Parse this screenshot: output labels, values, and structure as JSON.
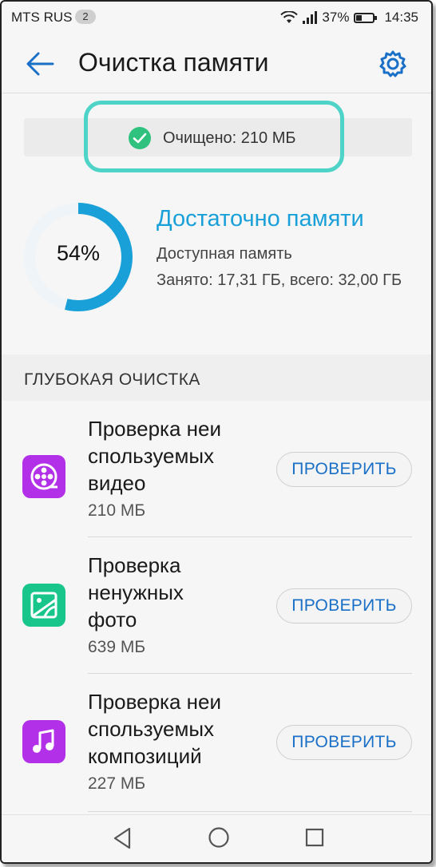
{
  "status_bar": {
    "carrier": "MTS RUS",
    "sim_badge": "2",
    "battery": "37%",
    "battery_level": 0.37,
    "time": "14:35"
  },
  "header": {
    "title": "Очистка памяти",
    "back_icon": "arrow-left-icon",
    "settings_icon": "gear-icon"
  },
  "banner": {
    "text": "Очищено: 210 МБ",
    "icon": "check-circle-icon",
    "highlight_color": "#4dd3c8"
  },
  "memory": {
    "percent_label": "54%",
    "percent": 54,
    "status": "Достаточно памяти",
    "available_label": "Доступная память",
    "used_text": "Занято: 17,31 ГБ, всего: 32,00 ГБ",
    "ring_color": "#1aa0d8"
  },
  "section": {
    "title": "ГЛУБОКАЯ ОЧИСТКА"
  },
  "items": [
    {
      "title_lines": [
        "Проверка неи",
        "спользуемых",
        "видео"
      ],
      "size": "210 МБ",
      "button": "ПРОВЕРИТЬ",
      "icon": "video-reel-icon",
      "icon_color": "#b230e8"
    },
    {
      "title_lines": [
        "Проверка",
        "ненужных",
        "фото"
      ],
      "size": "639 МБ",
      "button": "ПРОВЕРИТЬ",
      "icon": "photo-icon",
      "icon_color": "#18c58a"
    },
    {
      "title_lines": [
        "Проверка неи",
        "спользуемых",
        "композиций"
      ],
      "size": "227 МБ",
      "button": "ПРОВЕРИТЬ",
      "icon": "music-note-icon",
      "icon_color": "#b230e8"
    }
  ],
  "accent_color": "#1a6fc7"
}
